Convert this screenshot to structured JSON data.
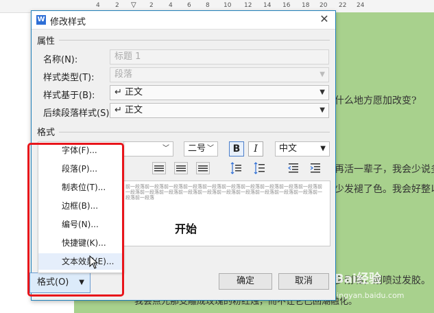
{
  "ruler": {
    "labels": [
      "4",
      "2",
      "2",
      "4",
      "6",
      "8",
      "10",
      "12",
      "14",
      "16",
      "18",
      "20",
      "22",
      "24"
    ]
  },
  "background": {
    "lines": [
      "什么地方愿加改变?",
      "再活一辈子，我会少说多",
      "少发褪了色。我会好整以",
      "多刚嘴，刚喷过发胶。",
      "我会点光那支雕成玫瑰的粉红烛，而不让它已回潮融化。"
    ],
    "watermark_main": "Bai",
    "watermark_sub": "经验",
    "watermark_url": "jingyan.baidu.com"
  },
  "dialog": {
    "title": "修改样式",
    "app_icon": "W",
    "close_glyph": "✕",
    "section_properties": "属性",
    "section_format": "格式",
    "fields": [
      {
        "label": "名称(N):",
        "value": "标题 1",
        "disabled": true,
        "has_arrow": false
      },
      {
        "label": "样式类型(T):",
        "value": "段落",
        "disabled": true,
        "has_arrow": true
      },
      {
        "label": "样式基于(B):",
        "value": "↵ 正文",
        "disabled": false,
        "has_arrow": true
      },
      {
        "label": "后续段落样式(S):",
        "value": "↵ 正文",
        "disabled": false,
        "has_arrow": true
      }
    ],
    "font_size": "二号",
    "bold_label": "B",
    "italic_label": "I",
    "language": "中文",
    "preview_dummy": "前一段落前一段落前一段落前一段落前一段落前一段落前一段落前一段落前一段落前一段落前一段落前一段落前一段落前一段落前一段落前一段落前一段落前一段落前一段落前一段落前一段落前一段落",
    "preview_sample": "开始",
    "ok_label": "确定",
    "cancel_label": "取消",
    "format_button_label": "格式(O)"
  },
  "format_menu": {
    "items": [
      "字体(F)...",
      "段落(P)...",
      "制表位(T)...",
      "边框(B)...",
      "编号(N)...",
      "快捷键(K)...",
      "文本效果(E)..."
    ],
    "hovered_index": 6
  },
  "colors": {
    "page_green": "#a8d18d",
    "dialog_border": "#1f7fb9",
    "highlight_red": "#e8141a"
  }
}
